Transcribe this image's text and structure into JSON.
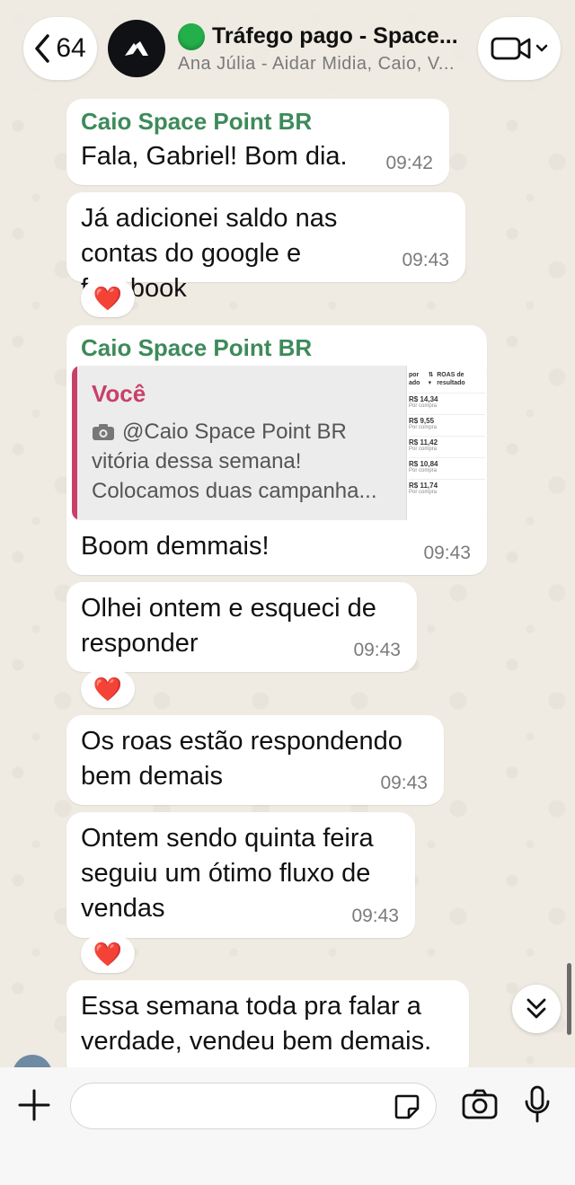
{
  "header": {
    "back_count": "64",
    "group_title": "Tráfego pago - Space...",
    "group_members": "Ana Júlia - Aidar Midia, Caio, V..."
  },
  "messages": [
    {
      "sender": "Caio Space Point BR",
      "text": "Fala, Gabriel! Bom dia.",
      "time": "09:42"
    },
    {
      "text": "Já adicionei saldo nas contas do google e facebook",
      "time": "09:43",
      "reaction": "❤️"
    },
    {
      "sender": "Caio Space Point BR",
      "quote": {
        "author": "Você",
        "mention": "@Caio Space Point BR",
        "line2": "vitória dessa semana!",
        "line3": "Colocamos duas campanha...",
        "thumb": {
          "col1": "por ado",
          "col2": "ROAS de resultado",
          "rows": [
            {
              "value": "R$ 14,34",
              "sub": "Por compra"
            },
            {
              "value": "R$ 9,55",
              "sub": "Por compra"
            },
            {
              "value": "R$ 11,42",
              "sub": "Por compra"
            },
            {
              "value": "R$ 10,84",
              "sub": "Por compra"
            },
            {
              "value": "R$ 11,74",
              "sub": "Por compra"
            }
          ]
        }
      },
      "text": "Boom demmais!",
      "time": "09:43"
    },
    {
      "text": "Olhei ontem e esqueci de responder",
      "time": "09:43",
      "reaction": "❤️"
    },
    {
      "text": "Os roas estão respondendo bem demais",
      "time": "09:43"
    },
    {
      "text": "Ontem sendo quinta feira seguiu um ótimo fluxo de vendas",
      "time": "09:43",
      "reaction": "❤️"
    },
    {
      "text": "Essa semana toda pra falar a verdade, vendeu bem demais."
    }
  ],
  "composer": {
    "placeholder": ""
  },
  "colors": {
    "sender": "#3e8a5a",
    "quote_accent": "#c8406a",
    "status_dot": "#23b04a",
    "reaction": "#e0102f"
  }
}
